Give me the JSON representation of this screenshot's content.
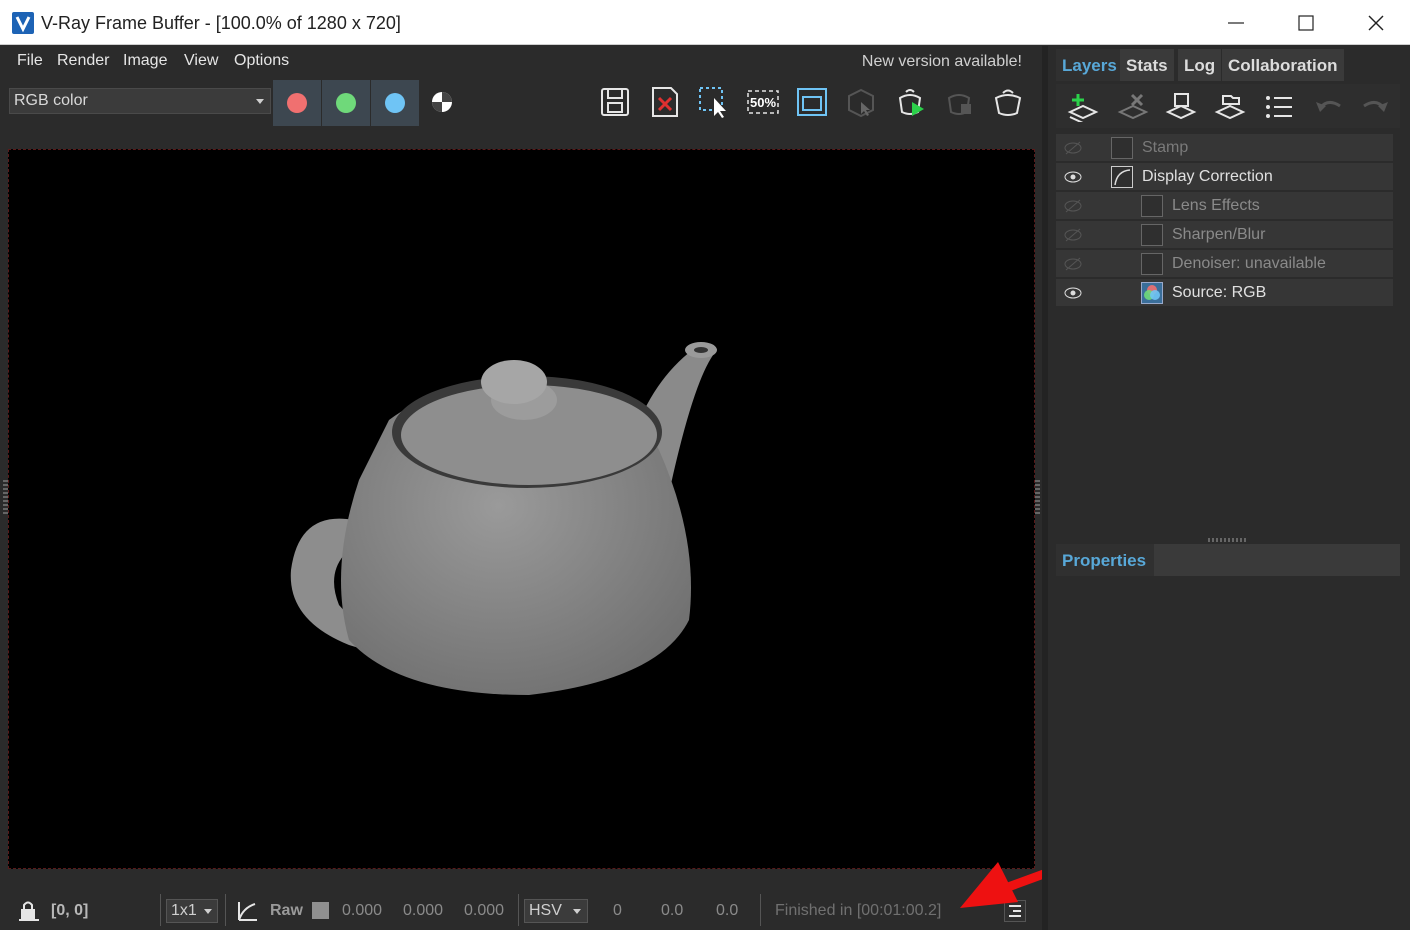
{
  "window": {
    "title": "V-Ray Frame Buffer - [100.0% of 1280 x 720]"
  },
  "menu": {
    "items": [
      "File",
      "Render",
      "Image",
      "View",
      "Options"
    ],
    "notice": "New version available!"
  },
  "toolbar": {
    "channel": "RGB color",
    "channel_colors": {
      "red": "#f07070",
      "green": "#6fd97a",
      "blue": "#6fc4f5"
    },
    "icons": [
      "save-icon",
      "clear-image-icon",
      "region-render-icon",
      "zoom-50-icon",
      "track-mouse-icon",
      "render-interactive-icon",
      "render-icon",
      "stop-render-icon",
      "render-last-icon"
    ],
    "zoom_label": "50%"
  },
  "statusbar": {
    "coords": "[0, 0]",
    "sample_size": "1x1",
    "raw_label": "Raw",
    "raw_values": [
      "0.000",
      "0.000",
      "0.000"
    ],
    "color_mode": "HSV",
    "hsv_values": [
      "0",
      "0.0",
      "0.0"
    ],
    "render_status": "Finished in [00:01:00.2]"
  },
  "right_panel": {
    "tabs": [
      "Layers",
      "Stats",
      "Log",
      "Collaboration"
    ],
    "active_tab": "Layers",
    "layers": [
      {
        "name": "Stamp",
        "visible": false,
        "indent": 0
      },
      {
        "name": "Display Correction",
        "visible": true,
        "indent": 0
      },
      {
        "name": "Lens Effects",
        "visible": false,
        "indent": 1
      },
      {
        "name": "Sharpen/Blur",
        "visible": false,
        "indent": 1
      },
      {
        "name": "Denoiser: unavailable",
        "visible": false,
        "indent": 1
      },
      {
        "name": "Source: RGB",
        "visible": true,
        "indent": 1
      }
    ],
    "properties_label": "Properties"
  }
}
